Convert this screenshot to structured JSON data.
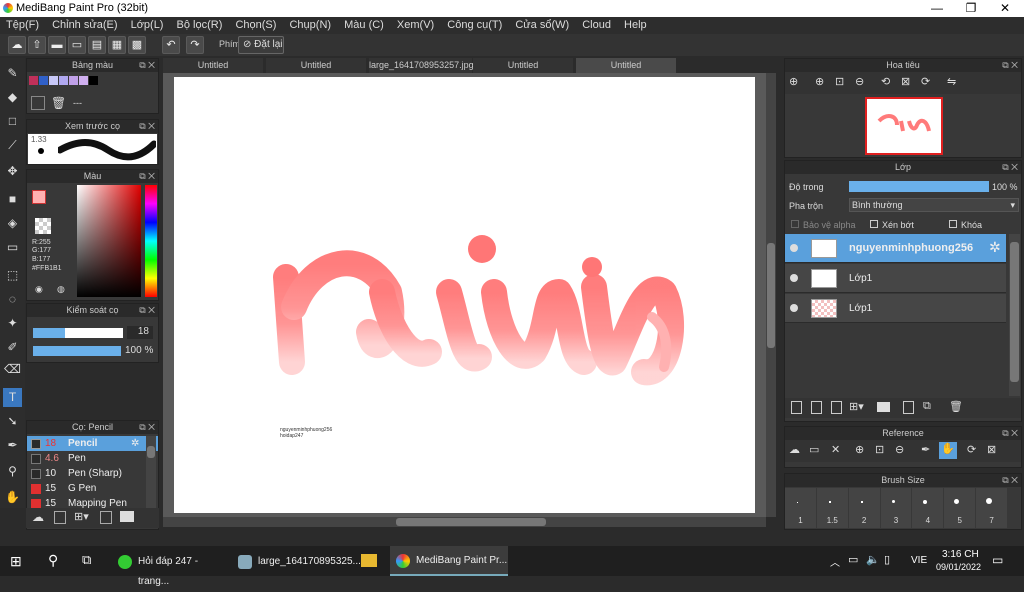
{
  "window": {
    "title": "MediBang Paint Pro (32bit)",
    "min": "—",
    "max": "❐",
    "close": "✕"
  },
  "menu": [
    "Tệp(F)",
    "Chỉnh sửa(E)",
    "Lớp(L)",
    "Bộ lọc(R)",
    "Chọn(S)",
    "Chụp(N)",
    "Màu (C)",
    "Xem(V)",
    "Công cụ(T)",
    "Cửa sổ(W)",
    "Cloud",
    "Help"
  ],
  "toolbar": {
    "shortcut_label": "Phím",
    "reset_label": "Đặt lại"
  },
  "tabs": [
    "Untitled",
    "Untitled",
    "large_1641708953257.jpg",
    "Untitled",
    "Untitled"
  ],
  "palette": {
    "title": "Bảng màu",
    "colors": [
      "#c0305a",
      "#3060c8",
      "#c8c8f8",
      "#b0a8f0",
      "#c0a0e8",
      "#d0b0f0",
      "#000000"
    ],
    "dashes": "---"
  },
  "brush_preview": {
    "title": "Xem trước cọ",
    "size": "1.33"
  },
  "color": {
    "title": "Màu",
    "r": "R:255",
    "g": "G:177",
    "b": "B:177",
    "hex": "#FFB1B1"
  },
  "brush_control": {
    "title": "Kiểm soát cọ",
    "size": "18",
    "opacity": "100 %"
  },
  "brushes": {
    "title": "Cọ: Pencil",
    "items": [
      {
        "size": "18",
        "name": "Pencil",
        "color": "#e8e8e8"
      },
      {
        "size": "4.6",
        "name": "Pen",
        "color": "#f0f0f0"
      },
      {
        "size": "10",
        "name": "Pen (Sharp)",
        "color": "#f0f0f0"
      },
      {
        "size": "15",
        "name": "G Pen",
        "color": "#e03030"
      },
      {
        "size": "15",
        "name": "Mapping Pen",
        "color": "#e03030"
      }
    ]
  },
  "canvas": {
    "signature_line1": "nguyenminhphuong256",
    "signature_line2": "hoidap247"
  },
  "navigator": {
    "title": "Hoa tiêu"
  },
  "layers": {
    "title": "Lớp",
    "opacity_label": "Độ trong",
    "opacity_value": "100 %",
    "opacity": 1.0,
    "blend_label": "Pha trộn",
    "blend_value": "Bình thường",
    "protect_alpha": "Bảo vệ alpha",
    "clip": "Xén bớt",
    "lock": "Khóa",
    "items": [
      "nguyenminhphuong256",
      "Lớp1",
      "Lớp1"
    ]
  },
  "reference": {
    "title": "Reference"
  },
  "brush_size": {
    "title": "Brush Size",
    "sizes": [
      "1",
      "1.5",
      "2",
      "3",
      "4",
      "5",
      "7"
    ]
  },
  "taskbar": {
    "items": [
      "Hỏi đáp 247 - trang...",
      "large_164170895325...",
      "MediBang Paint Pr..."
    ],
    "lang": "VIE",
    "time": "3:16 CH",
    "date": "09/01/2022"
  }
}
